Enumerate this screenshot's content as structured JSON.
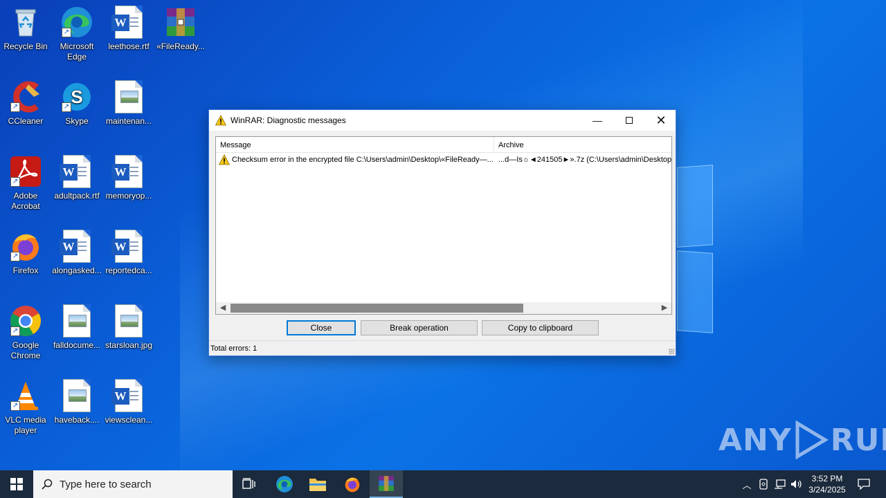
{
  "desktop": {
    "icons": [
      {
        "label": "Recycle Bin"
      },
      {
        "label": "Microsoft Edge"
      },
      {
        "label": "leethose.rtf"
      },
      {
        "label": "«FileReady..."
      },
      {
        "label": "CCleaner"
      },
      {
        "label": "Skype"
      },
      {
        "label": "maintenan..."
      },
      {
        "label": "Adobe Acrobat"
      },
      {
        "label": "adultpack.rtf"
      },
      {
        "label": "memoryop..."
      },
      {
        "label": "Firefox"
      },
      {
        "label": "alongasked..."
      },
      {
        "label": "reportedca..."
      },
      {
        "label": "Google Chrome"
      },
      {
        "label": "falldocume..."
      },
      {
        "label": "starsloan.jpg"
      },
      {
        "label": "VLC media player"
      },
      {
        "label": "haveback...."
      },
      {
        "label": "viewsclean..."
      }
    ]
  },
  "dialog": {
    "title": "WinRAR: Diagnostic messages",
    "columns": {
      "message": "Message",
      "archive": "Archive"
    },
    "rows": [
      {
        "message": "Checksum error in the encrypted file C:\\Users\\admin\\Desktop\\«FileReady—...",
        "archive": "...d—Is☼◄241505►».7z (C:\\Users\\admin\\Desktop"
      }
    ],
    "buttons": {
      "close": "Close",
      "break": "Break operation",
      "copy": "Copy to clipboard"
    },
    "status": "Total errors: 1"
  },
  "watermark": {
    "left": "ANY",
    "right": "RUN"
  },
  "taskbar": {
    "search_placeholder": "Type here to search",
    "clock": {
      "time": "3:52 PM",
      "date": "3/24/2025"
    }
  },
  "colors": {
    "accent": "#0078d7",
    "taskbar": "#1b2a3c",
    "desktop": "#0b68de"
  }
}
